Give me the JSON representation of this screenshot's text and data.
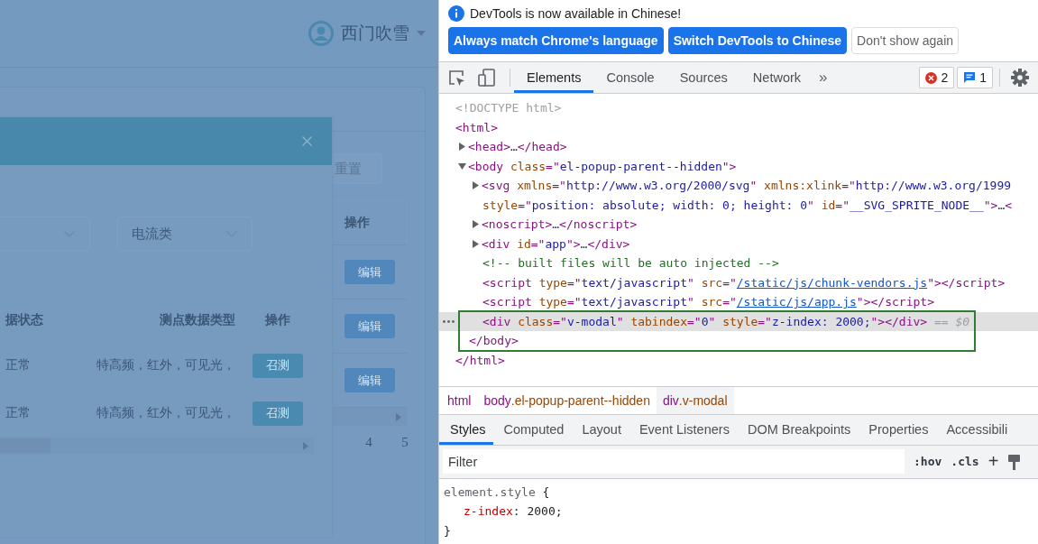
{
  "page": {
    "user": {
      "name": "西门吹雪"
    },
    "reset_button": "重置",
    "table": {
      "action_header": "操作",
      "rows": [
        {
          "action": "编辑"
        },
        {
          "action": "编辑"
        },
        {
          "action": "编辑"
        }
      ]
    },
    "pagination": [
      {
        "label": "4"
      },
      {
        "label": "5"
      }
    ]
  },
  "dialog": {
    "selects": [
      {
        "kind": "partial"
      },
      {
        "kind": "full",
        "value": "电流类"
      }
    ],
    "table": {
      "columns": [
        "据状态",
        "测点数据类型",
        "操作"
      ],
      "rows": [
        {
          "status": "正常",
          "data_types": "特高频，红外，可见光，",
          "action": "召测"
        },
        {
          "status": "正常",
          "data_types": "特高频，红外，可见光，",
          "action": "召测"
        }
      ]
    }
  },
  "devtools": {
    "infobar": {
      "message": "DevTools is now available in Chinese!",
      "buttons": [
        {
          "label": "Always match Chrome's language",
          "kind": "primary"
        },
        {
          "label": "Switch DevTools to Chinese",
          "kind": "primary"
        },
        {
          "label": "Don't show again",
          "kind": "secondary"
        }
      ]
    },
    "tabs": [
      {
        "label": "Elements",
        "selected": true
      },
      {
        "label": "Console",
        "selected": false
      },
      {
        "label": "Sources",
        "selected": false
      },
      {
        "label": "Network",
        "selected": false
      }
    ],
    "more_tabs": "»",
    "error_count": "2",
    "message_count": "1",
    "elements_tree": [
      {
        "selected": false,
        "lines": [
          [
            {
              "kind": "doctype",
              "text": "<!DOCTYPE html>"
            }
          ]
        ]
      },
      {
        "selected": false,
        "lines": [
          [
            {
              "kind": "tag",
              "text": "<html>"
            }
          ]
        ],
        "children": [
          {
            "selected": false,
            "expanded": false,
            "lines": [
              [
                {
                  "kind": "tag",
                  "text": "<head>"
                },
                {
                  "kind": "plain",
                  "text": "…"
                },
                {
                  "kind": "tag",
                  "text": "</head>"
                }
              ]
            ]
          },
          {
            "selected": false,
            "expanded": true,
            "lines": [
              [
                {
                  "kind": "tag",
                  "text": "<body "
                },
                {
                  "kind": "attr",
                  "text": "class"
                },
                {
                  "kind": "tag",
                  "text": "=\""
                },
                {
                  "kind": "value",
                  "text": "el-popup-parent--hidden"
                },
                {
                  "kind": "tag",
                  "text": "\">"
                }
              ]
            ],
            "children": [
              {
                "selected": false,
                "expanded": false,
                "lines": [
                  [
                    {
                      "kind": "tag",
                      "text": "<svg "
                    },
                    {
                      "kind": "attr",
                      "text": "xmlns"
                    },
                    {
                      "kind": "tag",
                      "text": "=\""
                    },
                    {
                      "kind": "value",
                      "text": "http://www.w3.org/2000/svg"
                    },
                    {
                      "kind": "tag",
                      "text": "\" "
                    },
                    {
                      "kind": "attr",
                      "text": "xmlns:xlink"
                    },
                    {
                      "kind": "tag",
                      "text": "=\""
                    },
                    {
                      "kind": "value",
                      "text": "http://www.w3.org/1999"
                    }
                  ],
                  [
                    {
                      "kind": "attr",
                      "text": "style"
                    },
                    {
                      "kind": "tag",
                      "text": "=\""
                    },
                    {
                      "kind": "value",
                      "text": "position: absolute; width: 0; height: 0"
                    },
                    {
                      "kind": "tag",
                      "text": "\" "
                    },
                    {
                      "kind": "attr",
                      "text": "id"
                    },
                    {
                      "kind": "tag",
                      "text": "=\""
                    },
                    {
                      "kind": "value",
                      "text": "__SVG_SPRITE_NODE__"
                    },
                    {
                      "kind": "tag",
                      "text": "\">"
                    },
                    {
                      "kind": "plain",
                      "text": "…"
                    },
                    {
                      "kind": "tag",
                      "text": "<"
                    }
                  ]
                ]
              },
              {
                "selected": false,
                "expanded": false,
                "lines": [
                  [
                    {
                      "kind": "tag",
                      "text": "<noscript>"
                    },
                    {
                      "kind": "plain",
                      "text": "…"
                    },
                    {
                      "kind": "tag",
                      "text": "</noscript>"
                    }
                  ]
                ]
              },
              {
                "selected": false,
                "expanded": false,
                "lines": [
                  [
                    {
                      "kind": "tag",
                      "text": "<div "
                    },
                    {
                      "kind": "attr",
                      "text": "id"
                    },
                    {
                      "kind": "tag",
                      "text": "=\""
                    },
                    {
                      "kind": "value",
                      "text": "app"
                    },
                    {
                      "kind": "tag",
                      "text": "\">"
                    },
                    {
                      "kind": "plain",
                      "text": "…"
                    },
                    {
                      "kind": "tag",
                      "text": "</div>"
                    }
                  ]
                ]
              },
              {
                "selected": false,
                "lines": [
                  [
                    {
                      "kind": "comment",
                      "text": "<!-- built files will be auto injected -->"
                    }
                  ]
                ]
              },
              {
                "selected": false,
                "lines": [
                  [
                    {
                      "kind": "tag",
                      "text": "<script "
                    },
                    {
                      "kind": "attr",
                      "text": "type"
                    },
                    {
                      "kind": "tag",
                      "text": "=\""
                    },
                    {
                      "kind": "value",
                      "text": "text/javascript"
                    },
                    {
                      "kind": "tag",
                      "text": "\" "
                    },
                    {
                      "kind": "attr",
                      "text": "src"
                    },
                    {
                      "kind": "tag",
                      "text": "=\""
                    },
                    {
                      "kind": "link",
                      "text": "/static/js/chunk-vendors.js"
                    },
                    {
                      "kind": "tag",
                      "text": "\"></script>"
                    }
                  ]
                ]
              },
              {
                "selected": false,
                "lines": [
                  [
                    {
                      "kind": "tag",
                      "text": "<script "
                    },
                    {
                      "kind": "attr",
                      "text": "type"
                    },
                    {
                      "kind": "tag",
                      "text": "=\""
                    },
                    {
                      "kind": "value",
                      "text": "text/javascript"
                    },
                    {
                      "kind": "tag",
                      "text": "\" "
                    },
                    {
                      "kind": "attr",
                      "text": "src"
                    },
                    {
                      "kind": "tag",
                      "text": "=\""
                    },
                    {
                      "kind": "link",
                      "text": "/static/js/app.js"
                    },
                    {
                      "kind": "tag",
                      "text": "\"></script>"
                    }
                  ]
                ]
              },
              {
                "selected": true,
                "lines": [
                  [
                    {
                      "kind": "tag",
                      "text": "<div "
                    },
                    {
                      "kind": "attr",
                      "text": "class"
                    },
                    {
                      "kind": "tag",
                      "text": "=\""
                    },
                    {
                      "kind": "value",
                      "text": "v-modal"
                    },
                    {
                      "kind": "tag",
                      "text": "\" "
                    },
                    {
                      "kind": "attr",
                      "text": "tabindex"
                    },
                    {
                      "kind": "tag",
                      "text": "=\""
                    },
                    {
                      "kind": "value",
                      "text": "0"
                    },
                    {
                      "kind": "tag",
                      "text": "\" "
                    },
                    {
                      "kind": "attr",
                      "text": "style"
                    },
                    {
                      "kind": "tag",
                      "text": "=\""
                    },
                    {
                      "kind": "value",
                      "text": "z-index: 2000;"
                    },
                    {
                      "kind": "tag",
                      "text": "\"></div>"
                    },
                    {
                      "kind": "marker",
                      "text": " == "
                    },
                    {
                      "kind": "var",
                      "text": "$0"
                    }
                  ]
                ]
              }
            ],
            "close": [
              [
                {
                  "kind": "tag",
                  "text": "</body>"
                }
              ]
            ]
          }
        ],
        "close": [
          [
            {
              "kind": "tag",
              "text": "</html>"
            }
          ]
        ]
      }
    ],
    "breadcrumbs": [
      {
        "label": "html",
        "selected": false
      },
      {
        "label": "body.el-popup-parent--hidden",
        "selected": false
      },
      {
        "label": "div.v-modal",
        "selected": true
      }
    ],
    "sub_tabs": [
      {
        "label": "Styles",
        "selected": true
      },
      {
        "label": "Computed",
        "selected": false
      },
      {
        "label": "Layout",
        "selected": false
      },
      {
        "label": "Event Listeners",
        "selected": false
      },
      {
        "label": "DOM Breakpoints",
        "selected": false
      },
      {
        "label": "Properties",
        "selected": false
      },
      {
        "label": "Accessibili",
        "selected": false
      }
    ],
    "filter": {
      "placeholder": "Filter"
    },
    "hov": ":hov",
    "cls": ".cls",
    "add": "+",
    "styles": {
      "selector": "element.style",
      "open": "{",
      "declarations": [
        {
          "property": "z-index",
          "colon": ":",
          "value": "2000;"
        }
      ],
      "close": "}"
    }
  }
}
